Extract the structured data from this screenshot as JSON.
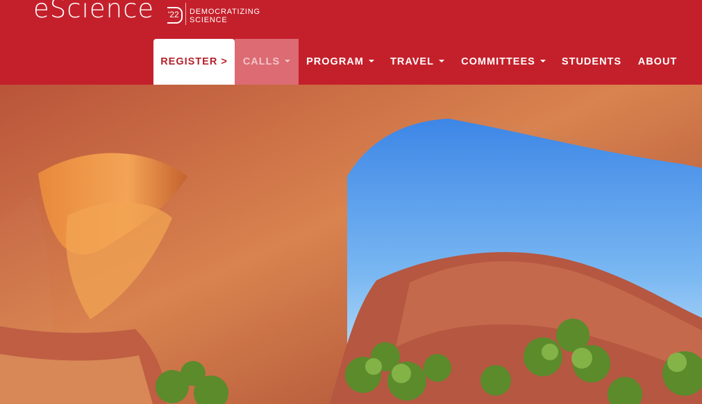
{
  "brand": {
    "name": "eScience",
    "year": "'22",
    "tagline_line1": "DEMOCRATIZING",
    "tagline_line2": "SCIENCE"
  },
  "nav": {
    "register": "REGISTER >",
    "calls": "CALLS",
    "program": "PROGRAM",
    "travel": "TRAVEL",
    "committees": "COMMITTEES",
    "students": "STUDENTS",
    "about": "ABOUT"
  },
  "hero": {
    "image": "red sandstone arch with blue sky and green trees"
  },
  "colors": {
    "brand_red": "#c4202b",
    "white": "#ffffff",
    "calls_bg": "#dc6b73",
    "register_text": "#b3202a"
  }
}
